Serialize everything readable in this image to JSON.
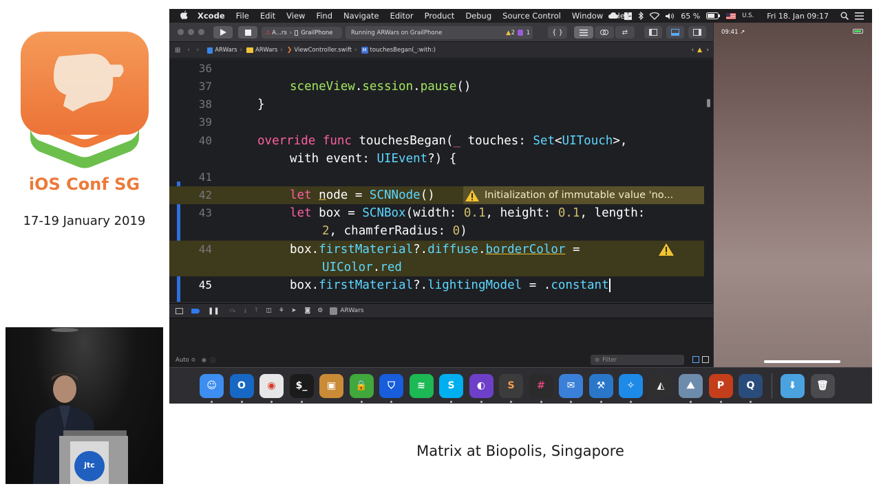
{
  "conference": {
    "name": "iOS Conf SG",
    "dates": "17-19 January 2019"
  },
  "caption": "Matrix at Biopolis, Singapore",
  "badge_text": "jtc",
  "menubar": {
    "app_name": "Xcode",
    "items": [
      "File",
      "Edit",
      "View",
      "Find",
      "Navigate",
      "Editor",
      "Product",
      "Debug",
      "Source Control",
      "Window",
      "Help"
    ],
    "battery": "65 %",
    "input_source": "U.S.",
    "datetime": "Fri 18. Jan  09:17"
  },
  "toolbar": {
    "scheme": "A...rs",
    "device": "GrailPhone",
    "activity": "Running ARWars on GrailPhone",
    "warning_count": "2",
    "issue_count": "1"
  },
  "jumpbar": {
    "crumbs": [
      "ARWars",
      "ARWars",
      "ViewController.swift",
      "touchesBegan(_:with:)"
    ],
    "method_badge": "M"
  },
  "editor": {
    "line_numbers": [
      "36",
      "37",
      "38",
      "39",
      "40",
      "41",
      "42",
      "43",
      "44",
      "45"
    ],
    "warning_message": "Initialization of immutable value 'no...",
    "current_line": "45"
  },
  "debug": {
    "target": "ARWars",
    "auto_label": "Auto ≎",
    "filter_placeholder": "Filter"
  },
  "simulator": {
    "time": "09:41 ↗"
  },
  "dock": [
    {
      "name": "finder",
      "glyph": "☺",
      "bg": "#3d8ef0"
    },
    {
      "name": "outlook",
      "glyph": "O",
      "bg": "#1768c4"
    },
    {
      "name": "chrome",
      "glyph": "◉",
      "bg": "#e7e7e7"
    },
    {
      "name": "terminal",
      "glyph": "$_",
      "bg": "#1b1b1b"
    },
    {
      "name": "preview",
      "glyph": "▣",
      "bg": "#c98b36"
    },
    {
      "name": "lock",
      "glyph": "🔒",
      "bg": "#40a83c"
    },
    {
      "name": "bitwarden",
      "glyph": "⛉",
      "bg": "#175ddc"
    },
    {
      "name": "spotify",
      "glyph": "≋",
      "bg": "#1db954"
    },
    {
      "name": "skype",
      "glyph": "S",
      "bg": "#00aff0"
    },
    {
      "name": "github",
      "glyph": "◐",
      "bg": "#6e40c9"
    },
    {
      "name": "sublime",
      "glyph": "S",
      "bg": "#3c3c3c"
    },
    {
      "name": "slack",
      "glyph": "#",
      "bg": "#2b2b2b"
    },
    {
      "name": "mail",
      "glyph": "✉",
      "bg": "#3b80d8"
    },
    {
      "name": "xcode",
      "glyph": "⚒",
      "bg": "#2a77c9"
    },
    {
      "name": "safari",
      "glyph": "✧",
      "bg": "#1d8ae8"
    },
    {
      "name": "unity",
      "glyph": "◭",
      "bg": "#2f2f2f"
    },
    {
      "name": "photos",
      "glyph": "⛰",
      "bg": "#6d8cab"
    },
    {
      "name": "powerpoint",
      "glyph": "P",
      "bg": "#c43e1c"
    },
    {
      "name": "quicktime",
      "glyph": "Q",
      "bg": "#2a4c7a"
    },
    {
      "name": "downloads",
      "glyph": "⬇",
      "bg": "#4aa3df"
    },
    {
      "name": "trash",
      "glyph": "🗑",
      "bg": "#4a4a4f"
    }
  ],
  "colors": {
    "keyword": "#fc5fa3",
    "type": "#5dd8ff",
    "project_symbol": "#a3e85f",
    "number": "#d0bf69",
    "warning_bg": "#59512a",
    "brand_orange": "#ec7a3a"
  }
}
